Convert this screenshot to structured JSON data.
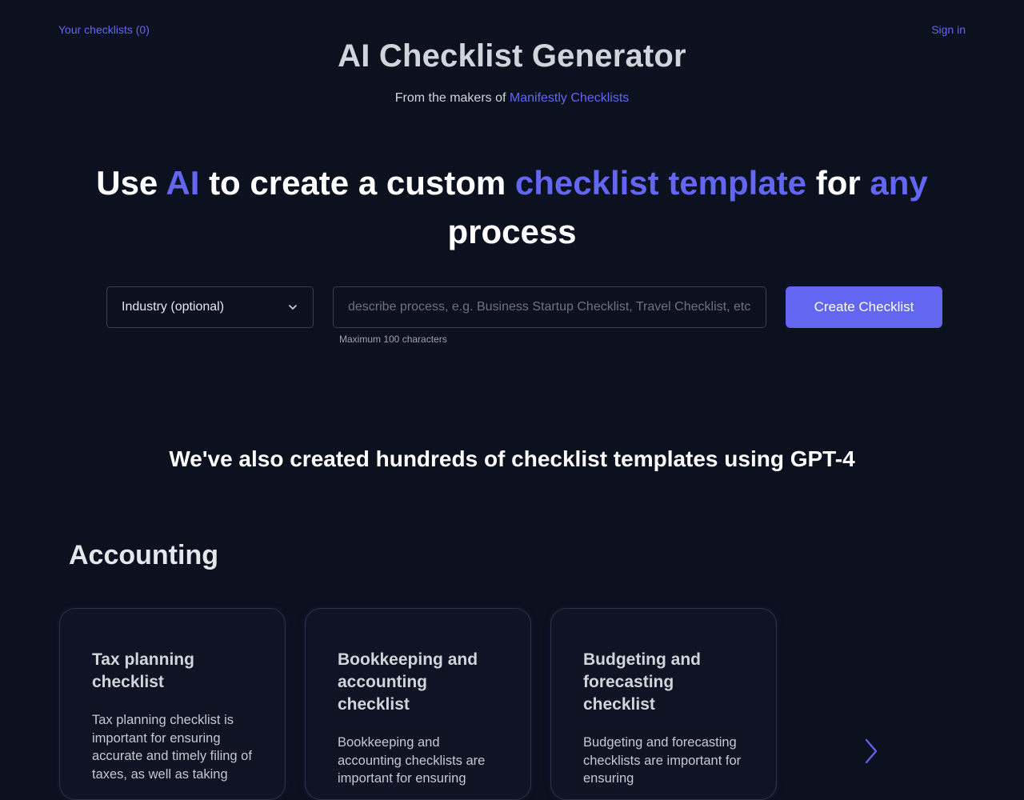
{
  "nav": {
    "your_checklists": "Your checklists (0)",
    "sign_in": "Sign in"
  },
  "header": {
    "title": "AI Checklist Generator",
    "subtitle_prefix": "From the makers of ",
    "subtitle_link": "Manifestly Checklists"
  },
  "hero": {
    "w1": "Use ",
    "w2": "AI",
    "w3": " to create a custom ",
    "w4": "checklist template",
    "w5": " for ",
    "w6": "any",
    "w7": " process"
  },
  "form": {
    "industry_selected": "Industry (optional)",
    "process_placeholder": "describe process, e.g. Business Startup Checklist, Travel Checklist, etc.",
    "helper_text": "Maximum 100 characters",
    "create_label": "Create Checklist"
  },
  "templates": {
    "section_title": "We've also created hundreds of checklist templates using GPT-4",
    "category": "Accounting",
    "cards": [
      {
        "title": "Tax planning checklist",
        "desc": "Tax planning checklist is important for ensuring accurate and timely filing of taxes, as well as taking"
      },
      {
        "title": "Bookkeeping and accounting checklist",
        "desc": "Bookkeeping and accounting checklists are important for ensuring"
      },
      {
        "title": "Budgeting and forecasting checklist",
        "desc": "Budgeting and forecasting checklists are important for ensuring"
      }
    ]
  },
  "icons": {
    "select": "chevron-down-icon",
    "carousel_next": "chevron-right-icon"
  },
  "colors": {
    "background": "#0c1120",
    "accent": "#6366f1",
    "text": "#e5e7eb"
  }
}
